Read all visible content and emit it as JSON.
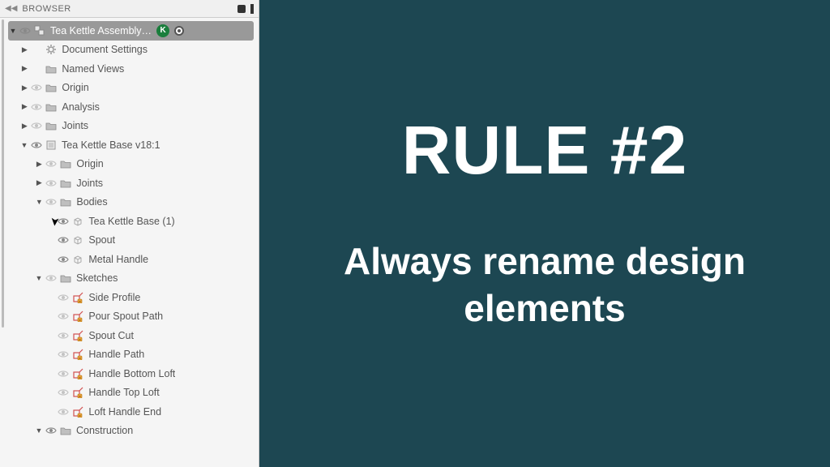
{
  "panel": {
    "title": "BROWSER"
  },
  "root": {
    "label": "Tea Kettle Assembly…",
    "badge": "K"
  },
  "topLevel": [
    {
      "label": "Document Settings",
      "icon": "gear",
      "tri": "right",
      "eye": null
    },
    {
      "label": "Named Views",
      "icon": "folder",
      "tri": "right",
      "eye": null
    },
    {
      "label": "Origin",
      "icon": "folder",
      "tri": "right",
      "eye": "off"
    },
    {
      "label": "Analysis",
      "icon": "folder",
      "tri": "right",
      "eye": "off"
    },
    {
      "label": "Joints",
      "icon": "folder",
      "tri": "right",
      "eye": "off"
    }
  ],
  "component": {
    "label": "Tea Kettle Base v18:1",
    "tri": "down",
    "eye": "on",
    "children": [
      {
        "label": "Origin",
        "icon": "folder",
        "tri": "right",
        "eye": "off",
        "indent": 1
      },
      {
        "label": "Joints",
        "icon": "folder",
        "tri": "right",
        "eye": "off",
        "indent": 1
      },
      {
        "label": "Bodies",
        "icon": "folder",
        "tri": "down",
        "eye": "off",
        "indent": 1
      }
    ],
    "bodies": [
      {
        "label": "Tea Kettle Base (1)"
      },
      {
        "label": "Spout"
      },
      {
        "label": "Metal Handle"
      }
    ],
    "sketchesHeader": {
      "label": "Sketches"
    },
    "sketches": [
      {
        "label": "Side Profile"
      },
      {
        "label": "Pour Spout Path"
      },
      {
        "label": "Spout Cut"
      },
      {
        "label": "Handle Path"
      },
      {
        "label": "Handle Bottom Loft"
      },
      {
        "label": "Handle Top Loft"
      },
      {
        "label": "Loft Handle End"
      }
    ],
    "construction": {
      "label": "Construction"
    }
  },
  "slide": {
    "heading": "RULE #2",
    "body": "Always rename design elements"
  }
}
